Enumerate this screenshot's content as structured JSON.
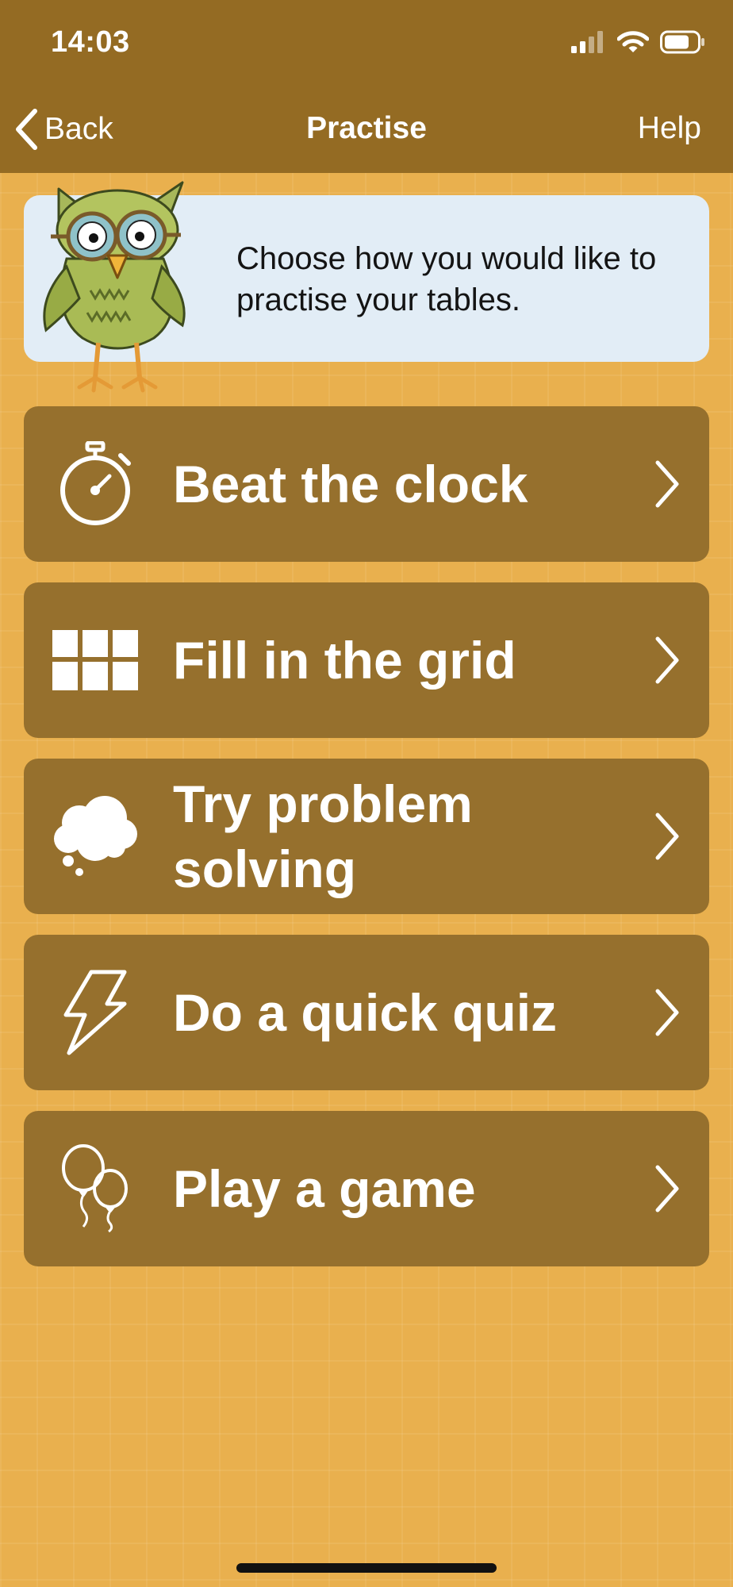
{
  "status_bar": {
    "time": "14:03"
  },
  "nav_bar": {
    "back_label": "Back",
    "title": "Practise",
    "help_label": "Help"
  },
  "info": {
    "text": "Choose how you would like to practise your tables."
  },
  "menu": {
    "items": [
      {
        "label": "Beat the clock",
        "icon": "stopwatch-icon"
      },
      {
        "label": "Fill in the grid",
        "icon": "grid-icon"
      },
      {
        "label": "Try problem solving",
        "icon": "thought-cloud-icon"
      },
      {
        "label": "Do a quick quiz",
        "icon": "lightning-icon"
      },
      {
        "label": "Play a game",
        "icon": "balloons-icon"
      }
    ]
  },
  "colors": {
    "background": "#e9b04e",
    "nav_bar": "#946b23",
    "menu_item": "#96702d",
    "info_card": "#e2edf6",
    "text_light": "#ffffff"
  }
}
